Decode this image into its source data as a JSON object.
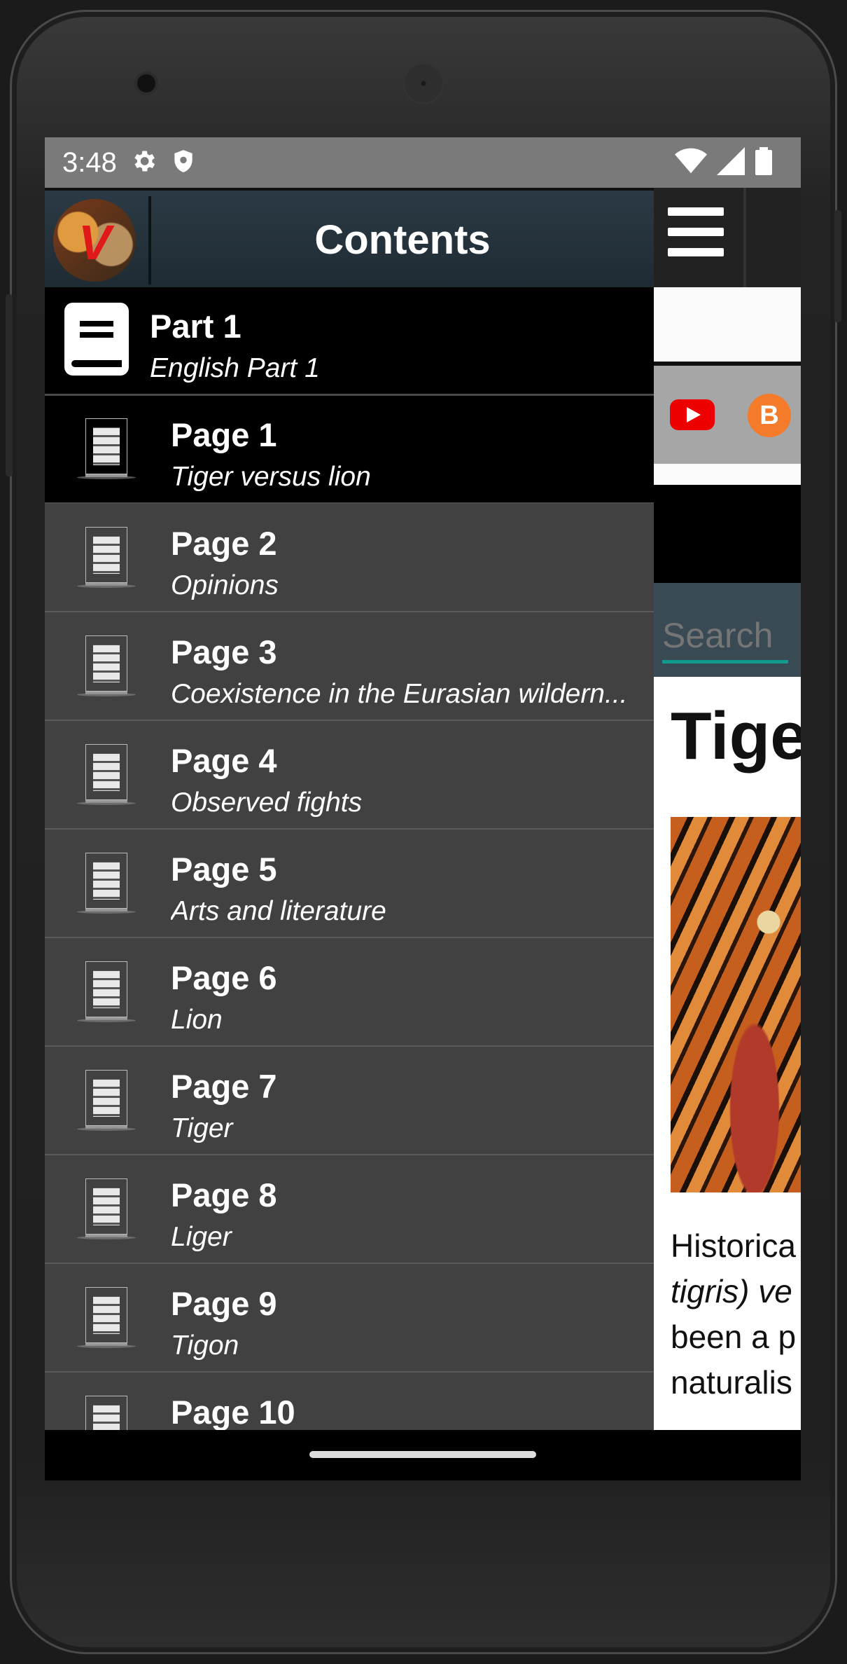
{
  "status": {
    "time": "3:48"
  },
  "header": {
    "title": "Contents"
  },
  "part": {
    "title": "Part 1",
    "subtitle": "English Part 1"
  },
  "pages": [
    {
      "title": "Page 1",
      "subtitle": "Tiger versus lion"
    },
    {
      "title": "Page 2",
      "subtitle": "Opinions"
    },
    {
      "title": "Page 3",
      "subtitle": "Coexistence in the Eurasian wildern..."
    },
    {
      "title": "Page 4",
      "subtitle": "Observed fights"
    },
    {
      "title": "Page 5",
      "subtitle": "Arts and literature"
    },
    {
      "title": "Page 6",
      "subtitle": "Lion"
    },
    {
      "title": "Page 7",
      "subtitle": "Tiger"
    },
    {
      "title": "Page 8",
      "subtitle": "Liger"
    },
    {
      "title": "Page 9",
      "subtitle": "Tigon"
    },
    {
      "title": "Page 10",
      "subtitle": ""
    }
  ],
  "background": {
    "search_placeholder": "Search",
    "article_title": "Tige",
    "text_lines": [
      "Historica",
      "tigris) ve",
      "been a p",
      "naturalis"
    ]
  },
  "colors": {
    "drawer_bg": "#414141",
    "header_bg": "#24323c",
    "search_underline": "#109b8d",
    "youtube": "#ee0000",
    "blogger": "#f37b2a"
  }
}
